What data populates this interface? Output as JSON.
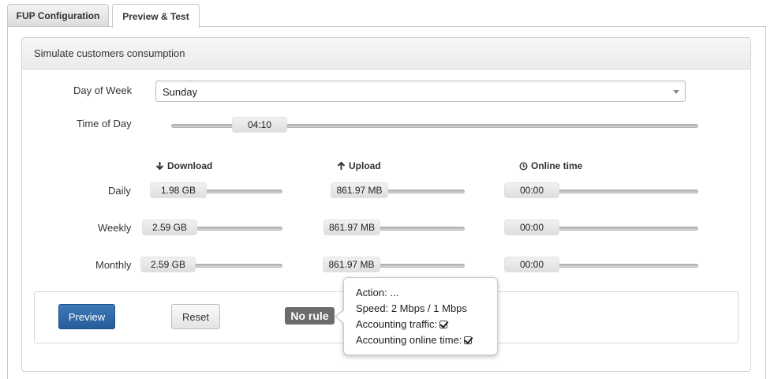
{
  "tabs": [
    {
      "label": "FUP Configuration"
    },
    {
      "label": "Preview & Test"
    }
  ],
  "panel": {
    "title": "Simulate customers consumption"
  },
  "day_of_week": {
    "label": "Day of Week",
    "value": "Sunday"
  },
  "time_of_day": {
    "label": "Time of Day",
    "value": "04:10"
  },
  "columns": {
    "download": "Download",
    "upload": "Upload",
    "online": "Online time"
  },
  "rows": [
    {
      "label": "Daily",
      "download": "1.98 GB",
      "upload": "861.97 MB",
      "online": "00:00"
    },
    {
      "label": "Weekly",
      "download": "2.59 GB",
      "upload": "861.97 MB",
      "online": "00:00"
    },
    {
      "label": "Monthly",
      "download": "2.59 GB",
      "upload": "861.97 MB",
      "online": "00:00"
    }
  ],
  "buttons": {
    "preview": "Preview",
    "reset": "Reset"
  },
  "badge": {
    "text": "No rule"
  },
  "popover": {
    "action": "Action: ...",
    "speed": "Speed: 2 Mbps / 1 Mbps",
    "accounting_traffic": "Accounting traffic:",
    "accounting_online_time": "Accounting online time:"
  },
  "icons": {
    "download": "arrow-down-icon",
    "upload": "arrow-up-icon",
    "online": "clock-icon",
    "caret": "caret-down-icon",
    "checkbox": "checkbox-checked-icon"
  },
  "colors": {
    "primary": "#2d66a8",
    "badge": "#6b6b6b"
  }
}
